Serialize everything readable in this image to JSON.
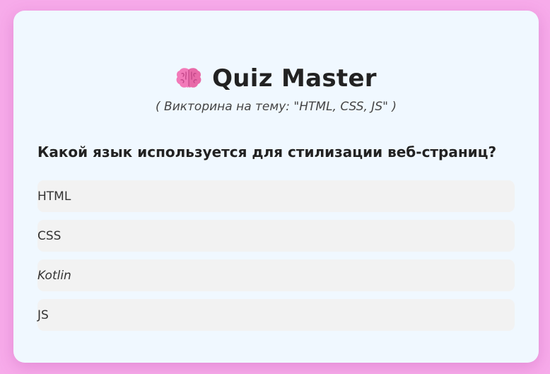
{
  "app": {
    "icon": "brain-icon",
    "title": "Quiz Master",
    "subtitle": "( Викторина на тему: \"HTML, CSS, JS\" )"
  },
  "quiz": {
    "question": "Какой язык используется для стилизации веб-страниц?",
    "options": [
      {
        "label": "HTML"
      },
      {
        "label": "CSS"
      },
      {
        "label": "Kotlin"
      },
      {
        "label": "JS"
      }
    ]
  },
  "colors": {
    "page_background": "#f7abea",
    "card_background": "#f0f8ff",
    "option_background": "#f2f2f2",
    "text": "#222222"
  }
}
